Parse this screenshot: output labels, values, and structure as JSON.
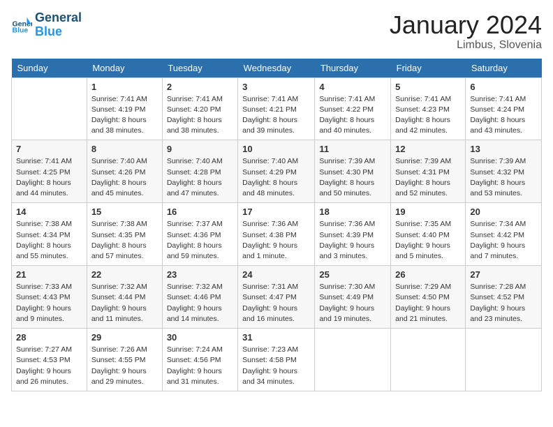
{
  "header": {
    "logo_general": "General",
    "logo_blue": "Blue",
    "month_year": "January 2024",
    "location": "Limbus, Slovenia"
  },
  "weekdays": [
    "Sunday",
    "Monday",
    "Tuesday",
    "Wednesday",
    "Thursday",
    "Friday",
    "Saturday"
  ],
  "weeks": [
    [
      {
        "day": "",
        "info": ""
      },
      {
        "day": "1",
        "info": "Sunrise: 7:41 AM\nSunset: 4:19 PM\nDaylight: 8 hours\nand 38 minutes."
      },
      {
        "day": "2",
        "info": "Sunrise: 7:41 AM\nSunset: 4:20 PM\nDaylight: 8 hours\nand 38 minutes."
      },
      {
        "day": "3",
        "info": "Sunrise: 7:41 AM\nSunset: 4:21 PM\nDaylight: 8 hours\nand 39 minutes."
      },
      {
        "day": "4",
        "info": "Sunrise: 7:41 AM\nSunset: 4:22 PM\nDaylight: 8 hours\nand 40 minutes."
      },
      {
        "day": "5",
        "info": "Sunrise: 7:41 AM\nSunset: 4:23 PM\nDaylight: 8 hours\nand 42 minutes."
      },
      {
        "day": "6",
        "info": "Sunrise: 7:41 AM\nSunset: 4:24 PM\nDaylight: 8 hours\nand 43 minutes."
      }
    ],
    [
      {
        "day": "7",
        "info": "Sunrise: 7:41 AM\nSunset: 4:25 PM\nDaylight: 8 hours\nand 44 minutes."
      },
      {
        "day": "8",
        "info": "Sunrise: 7:40 AM\nSunset: 4:26 PM\nDaylight: 8 hours\nand 45 minutes."
      },
      {
        "day": "9",
        "info": "Sunrise: 7:40 AM\nSunset: 4:28 PM\nDaylight: 8 hours\nand 47 minutes."
      },
      {
        "day": "10",
        "info": "Sunrise: 7:40 AM\nSunset: 4:29 PM\nDaylight: 8 hours\nand 48 minutes."
      },
      {
        "day": "11",
        "info": "Sunrise: 7:39 AM\nSunset: 4:30 PM\nDaylight: 8 hours\nand 50 minutes."
      },
      {
        "day": "12",
        "info": "Sunrise: 7:39 AM\nSunset: 4:31 PM\nDaylight: 8 hours\nand 52 minutes."
      },
      {
        "day": "13",
        "info": "Sunrise: 7:39 AM\nSunset: 4:32 PM\nDaylight: 8 hours\nand 53 minutes."
      }
    ],
    [
      {
        "day": "14",
        "info": "Sunrise: 7:38 AM\nSunset: 4:34 PM\nDaylight: 8 hours\nand 55 minutes."
      },
      {
        "day": "15",
        "info": "Sunrise: 7:38 AM\nSunset: 4:35 PM\nDaylight: 8 hours\nand 57 minutes."
      },
      {
        "day": "16",
        "info": "Sunrise: 7:37 AM\nSunset: 4:36 PM\nDaylight: 8 hours\nand 59 minutes."
      },
      {
        "day": "17",
        "info": "Sunrise: 7:36 AM\nSunset: 4:38 PM\nDaylight: 9 hours\nand 1 minute."
      },
      {
        "day": "18",
        "info": "Sunrise: 7:36 AM\nSunset: 4:39 PM\nDaylight: 9 hours\nand 3 minutes."
      },
      {
        "day": "19",
        "info": "Sunrise: 7:35 AM\nSunset: 4:40 PM\nDaylight: 9 hours\nand 5 minutes."
      },
      {
        "day": "20",
        "info": "Sunrise: 7:34 AM\nSunset: 4:42 PM\nDaylight: 9 hours\nand 7 minutes."
      }
    ],
    [
      {
        "day": "21",
        "info": "Sunrise: 7:33 AM\nSunset: 4:43 PM\nDaylight: 9 hours\nand 9 minutes."
      },
      {
        "day": "22",
        "info": "Sunrise: 7:32 AM\nSunset: 4:44 PM\nDaylight: 9 hours\nand 11 minutes."
      },
      {
        "day": "23",
        "info": "Sunrise: 7:32 AM\nSunset: 4:46 PM\nDaylight: 9 hours\nand 14 minutes."
      },
      {
        "day": "24",
        "info": "Sunrise: 7:31 AM\nSunset: 4:47 PM\nDaylight: 9 hours\nand 16 minutes."
      },
      {
        "day": "25",
        "info": "Sunrise: 7:30 AM\nSunset: 4:49 PM\nDaylight: 9 hours\nand 19 minutes."
      },
      {
        "day": "26",
        "info": "Sunrise: 7:29 AM\nSunset: 4:50 PM\nDaylight: 9 hours\nand 21 minutes."
      },
      {
        "day": "27",
        "info": "Sunrise: 7:28 AM\nSunset: 4:52 PM\nDaylight: 9 hours\nand 23 minutes."
      }
    ],
    [
      {
        "day": "28",
        "info": "Sunrise: 7:27 AM\nSunset: 4:53 PM\nDaylight: 9 hours\nand 26 minutes."
      },
      {
        "day": "29",
        "info": "Sunrise: 7:26 AM\nSunset: 4:55 PM\nDaylight: 9 hours\nand 29 minutes."
      },
      {
        "day": "30",
        "info": "Sunrise: 7:24 AM\nSunset: 4:56 PM\nDaylight: 9 hours\nand 31 minutes."
      },
      {
        "day": "31",
        "info": "Sunrise: 7:23 AM\nSunset: 4:58 PM\nDaylight: 9 hours\nand 34 minutes."
      },
      {
        "day": "",
        "info": ""
      },
      {
        "day": "",
        "info": ""
      },
      {
        "day": "",
        "info": ""
      }
    ]
  ]
}
